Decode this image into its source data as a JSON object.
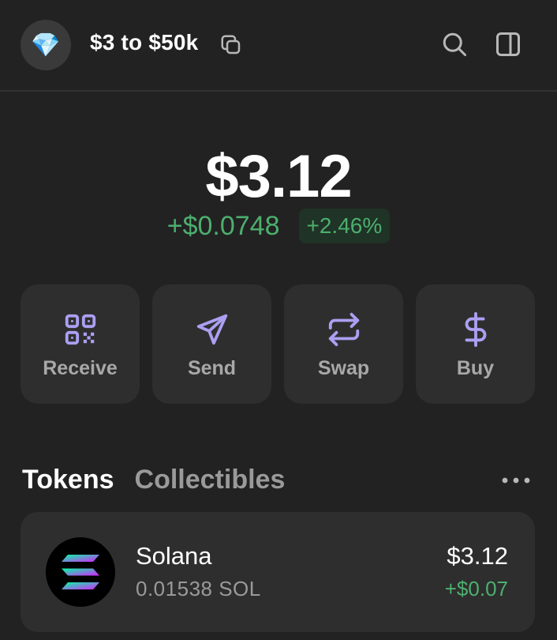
{
  "header": {
    "avatar_emoji": "💎",
    "account_name": "$3 to $50k",
    "icons": [
      "copy-icon",
      "search-icon",
      "sidebar-icon"
    ]
  },
  "portfolio": {
    "balance": "$3.12",
    "change_abs": "+$0.0748",
    "change_pct": "+2.46%"
  },
  "actions": [
    {
      "label": "Receive",
      "icon": "qr-code-icon"
    },
    {
      "label": "Send",
      "icon": "send-icon"
    },
    {
      "label": "Swap",
      "icon": "swap-icon"
    },
    {
      "label": "Buy",
      "icon": "dollar-icon"
    }
  ],
  "tabs": [
    {
      "label": "Tokens",
      "active": true
    },
    {
      "label": "Collectibles",
      "active": false
    }
  ],
  "tokens": [
    {
      "name": "Solana",
      "amount": "0.01538 SOL",
      "value": "$3.12",
      "change": "+$0.07",
      "icon": "solana-logo-icon"
    }
  ],
  "colors": {
    "background": "#222222",
    "card": "#2e2e2e",
    "accent": "#ab9ff2",
    "positive": "#4caf6e",
    "muted_text": "#9a9a9a"
  }
}
